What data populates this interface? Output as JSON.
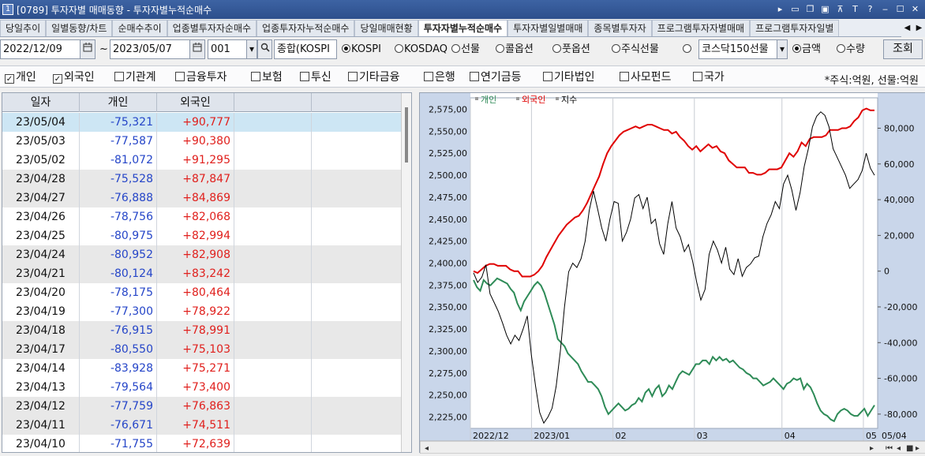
{
  "window": {
    "icon_text": "1",
    "title": "[0789] 투자자별 매매동향 - 투자자별누적순매수",
    "buttons": [
      "▸",
      "▭",
      "❐",
      "▣",
      "⊼",
      "T",
      "?",
      "‒",
      "☐",
      "✕"
    ]
  },
  "tabs": [
    "당일추이",
    "일별동향/차트",
    "순매수추이",
    "업종별투자자순매수",
    "업종투자자누적순매수",
    "당일매매현황",
    "투자자별누적순매수",
    "투자자별일별매매",
    "종목별투자자",
    "프로그램투자자별매매",
    "프로그램투자자일별"
  ],
  "active_tab": 6,
  "tab_scroll": [
    "◀",
    "▶"
  ],
  "controls": {
    "start_date": "2022/12/09",
    "tilde": "~",
    "end_date": "2023/05/07",
    "code": "001",
    "market_name": "종합(KOSPI",
    "kospi": "KOSPI",
    "kosdaq": "KOSDAQ",
    "futures": "선물",
    "call_option": "콜옵션",
    "put_option": "풋옵션",
    "stock_futures": "주식선물",
    "kosdaq150": "코스닥150선물",
    "amount": "금액",
    "quantity": "수량",
    "search_button": "조회"
  },
  "investors": [
    {
      "label": "개인",
      "checked": true
    },
    {
      "label": "외국인",
      "checked": true
    },
    {
      "label": "기관계",
      "checked": false
    },
    {
      "label": "금융투자",
      "checked": false
    },
    {
      "label": "보험",
      "checked": false
    },
    {
      "label": "투신",
      "checked": false
    },
    {
      "label": "기타금융",
      "checked": false
    },
    {
      "label": "은행",
      "checked": false
    },
    {
      "label": "연기금등",
      "checked": false
    },
    {
      "label": "기타법인",
      "checked": false
    },
    {
      "label": "사모펀드",
      "checked": false
    },
    {
      "label": "국가",
      "checked": false
    }
  ],
  "unit_note": "*주식:억원, 선물:억원",
  "table": {
    "headers": [
      "일자",
      "개인",
      "외국인"
    ],
    "rows": [
      [
        "23/05/04",
        "-75,321",
        "+90,777"
      ],
      [
        "23/05/03",
        "-77,587",
        "+90,380"
      ],
      [
        "23/05/02",
        "-81,072",
        "+91,295"
      ],
      [
        "23/04/28",
        "-75,528",
        "+87,847"
      ],
      [
        "23/04/27",
        "-76,888",
        "+84,869"
      ],
      [
        "23/04/26",
        "-78,756",
        "+82,068"
      ],
      [
        "23/04/25",
        "-80,975",
        "+82,994"
      ],
      [
        "23/04/24",
        "-80,952",
        "+82,908"
      ],
      [
        "23/04/21",
        "-80,124",
        "+83,242"
      ],
      [
        "23/04/20",
        "-78,175",
        "+80,464"
      ],
      [
        "23/04/19",
        "-77,300",
        "+78,922"
      ],
      [
        "23/04/18",
        "-76,915",
        "+78,991"
      ],
      [
        "23/04/17",
        "-80,550",
        "+75,103"
      ],
      [
        "23/04/14",
        "-83,928",
        "+75,271"
      ],
      [
        "23/04/13",
        "-79,564",
        "+73,400"
      ],
      [
        "23/04/12",
        "-77,759",
        "+76,863"
      ],
      [
        "23/04/11",
        "-76,671",
        "+74,511"
      ],
      [
        "23/04/10",
        "-71,755",
        "+72,639"
      ]
    ]
  },
  "chart_data": {
    "type": "line",
    "legend": [
      "개인",
      "외국인",
      "지수"
    ],
    "colors": {
      "개인": "#2e8b57",
      "외국인": "#e00000",
      "지수": "#000000"
    },
    "y_left_ticks": [
      "2,575,00",
      "2,550,00",
      "2,525,00",
      "2,500,00",
      "2,475,00",
      "2,450,00",
      "2,425,00",
      "2,400,00",
      "2,375,00",
      "2,350,00",
      "2,325,00",
      "2,300,00",
      "2,275,00",
      "2,250,00",
      "2,225,00"
    ],
    "y_left_range": [
      2212,
      2588
    ],
    "y_right_ticks": [
      "80,000",
      "60,000",
      "40,000",
      "20,000",
      "0",
      "-20,000",
      "-40,000",
      "-60,000",
      "-80,000"
    ],
    "y_right_range": [
      -88000,
      97000
    ],
    "x_ticks": [
      "2022/12",
      "2023/01",
      "02",
      "03",
      "04",
      "05"
    ],
    "x_current": "05/04",
    "series": [
      {
        "name": "개인",
        "axis": "right",
        "values": [
          -5000,
          -9000,
          -11000,
          -5000,
          -7000,
          -8000,
          -6000,
          -4000,
          -5000,
          -6000,
          -7000,
          -10000,
          -12000,
          -18000,
          -22000,
          -17000,
          -14000,
          -11000,
          -8000,
          -6000,
          -8000,
          -12000,
          -18000,
          -24000,
          -30000,
          -38000,
          -40000,
          -42000,
          -46000,
          -48000,
          -50000,
          -52000,
          -56000,
          -59000,
          -62000,
          -62000,
          -64000,
          -66000,
          -70000,
          -76000,
          -80000,
          -78000,
          -76000,
          -74000,
          -76000,
          -78000,
          -77000,
          -75000,
          -74000,
          -71000,
          -73000,
          -68000,
          -66000,
          -70000,
          -66000,
          -64000,
          -70000,
          -68000,
          -64000,
          -66000,
          -62000,
          -58000,
          -56000,
          -57000,
          -58000,
          -55000,
          -52000,
          -52000,
          -50000,
          -50000,
          -52000,
          -48000,
          -50000,
          -48000,
          -50000,
          -49000,
          -51000,
          -50000,
          -52000,
          -54000,
          -55000,
          -57000,
          -58000,
          -60000,
          -60000,
          -62000,
          -64000,
          -63000,
          -62000,
          -60000,
          -62000,
          -64000,
          -66000,
          -63000,
          -62000,
          -60000,
          -61000,
          -60000,
          -66000,
          -63000,
          -65000,
          -69000,
          -74000,
          -78000,
          -80000,
          -81000,
          -83000,
          -84000,
          -80000,
          -78000,
          -77000,
          -78000,
          -80000,
          -81000,
          -81000,
          -79000,
          -77000,
          -81000,
          -78000,
          -75000
        ]
      },
      {
        "name": "외국인",
        "axis": "right",
        "values": [
          0,
          -1000,
          1000,
          3000,
          4000,
          4000,
          3000,
          3000,
          3000,
          1000,
          0,
          0,
          -3000,
          -3000,
          -3000,
          -2000,
          0,
          3000,
          8000,
          12000,
          16000,
          20000,
          23000,
          26000,
          28000,
          30000,
          31000,
          34000,
          38000,
          43000,
          48000,
          53000,
          60000,
          66000,
          70000,
          73000,
          76000,
          78000,
          79000,
          80000,
          81000,
          80000,
          81000,
          82000,
          82000,
          81000,
          80000,
          79000,
          79000,
          77000,
          78000,
          75000,
          73000,
          70000,
          68000,
          70000,
          67000,
          69000,
          71000,
          69000,
          70000,
          67000,
          66000,
          62000,
          60000,
          58000,
          58000,
          58000,
          55000,
          55000,
          54000,
          54000,
          55000,
          57000,
          57000,
          57000,
          58000,
          62000,
          66000,
          64000,
          67000,
          72000,
          70000,
          74000,
          75000,
          75000,
          75000,
          76000,
          79000,
          79000,
          79000,
          80000,
          80000,
          81000,
          84000,
          86000,
          90000,
          91000,
          90000,
          90000
        ]
      },
      {
        "name": "지수",
        "axis": "left",
        "values": [
          2389,
          2378,
          2384,
          2398,
          2365,
          2355,
          2345,
          2332,
          2318,
          2308,
          2318,
          2312,
          2325,
          2340,
          2295,
          2260,
          2230,
          2218,
          2225,
          2235,
          2260,
          2300,
          2350,
          2390,
          2400,
          2395,
          2405,
          2425,
          2460,
          2482,
          2462,
          2440,
          2425,
          2450,
          2470,
          2468,
          2425,
          2435,
          2450,
          2474,
          2478,
          2462,
          2475,
          2445,
          2450,
          2422,
          2410,
          2445,
          2470,
          2440,
          2430,
          2413,
          2421,
          2402,
          2378,
          2358,
          2370,
          2410,
          2425,
          2415,
          2400,
          2418,
          2393,
          2387,
          2405,
          2385,
          2395,
          2399,
          2406,
          2408,
          2430,
          2445,
          2455,
          2470,
          2462,
          2490,
          2500,
          2483,
          2460,
          2480,
          2510,
          2530,
          2555,
          2567,
          2572,
          2568,
          2555,
          2530,
          2520,
          2510,
          2500,
          2485,
          2490,
          2495,
          2505,
          2525,
          2508,
          2500
        ]
      }
    ]
  }
}
